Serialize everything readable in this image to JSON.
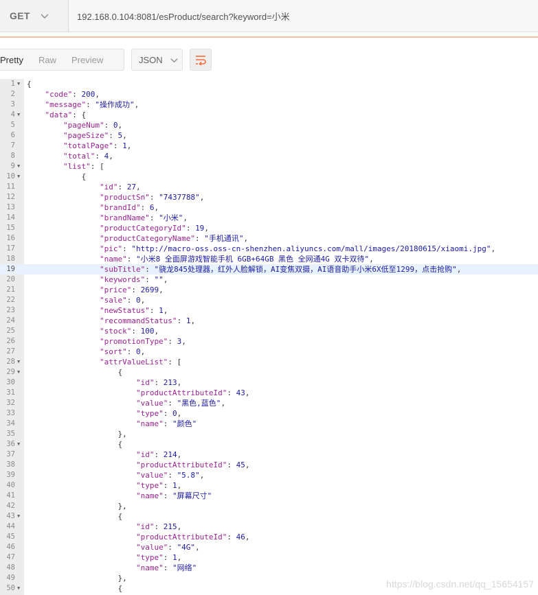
{
  "request": {
    "method": "GET",
    "url": "192.168.0.104:8081/esProduct/search?keyword=小米"
  },
  "toolbar": {
    "view_tabs": [
      "Pretty",
      "Raw",
      "Preview"
    ],
    "active_view": "Pretty",
    "format": "JSON",
    "wrap_icon": "wrap-lines-icon"
  },
  "watermark": "https://blog.csdn.net/qq_15654157",
  "code_lines": [
    {
      "n": 1,
      "fold": true,
      "indent": 0,
      "t": [
        [
          "{",
          "p"
        ]
      ]
    },
    {
      "n": 2,
      "indent": 1,
      "t": [
        [
          "\"code\"",
          "k"
        ],
        [
          ": ",
          "p"
        ],
        [
          "200",
          "n"
        ],
        [
          ",",
          "p"
        ]
      ]
    },
    {
      "n": 3,
      "indent": 1,
      "t": [
        [
          "\"message\"",
          "k"
        ],
        [
          ": ",
          "p"
        ],
        [
          "\"操作成功\"",
          "s"
        ],
        [
          ",",
          "p"
        ]
      ]
    },
    {
      "n": 4,
      "fold": true,
      "indent": 1,
      "t": [
        [
          "\"data\"",
          "k"
        ],
        [
          ": {",
          "p"
        ]
      ]
    },
    {
      "n": 5,
      "indent": 2,
      "t": [
        [
          "\"pageNum\"",
          "k"
        ],
        [
          ": ",
          "p"
        ],
        [
          "0",
          "n"
        ],
        [
          ",",
          "p"
        ]
      ]
    },
    {
      "n": 6,
      "indent": 2,
      "t": [
        [
          "\"pageSize\"",
          "k"
        ],
        [
          ": ",
          "p"
        ],
        [
          "5",
          "n"
        ],
        [
          ",",
          "p"
        ]
      ]
    },
    {
      "n": 7,
      "indent": 2,
      "t": [
        [
          "\"totalPage\"",
          "k"
        ],
        [
          ": ",
          "p"
        ],
        [
          "1",
          "n"
        ],
        [
          ",",
          "p"
        ]
      ]
    },
    {
      "n": 8,
      "indent": 2,
      "t": [
        [
          "\"total\"",
          "k"
        ],
        [
          ": ",
          "p"
        ],
        [
          "4",
          "n"
        ],
        [
          ",",
          "p"
        ]
      ]
    },
    {
      "n": 9,
      "fold": true,
      "indent": 2,
      "t": [
        [
          "\"list\"",
          "k"
        ],
        [
          ": [",
          "p"
        ]
      ]
    },
    {
      "n": 10,
      "fold": true,
      "indent": 3,
      "t": [
        [
          "{",
          "p"
        ]
      ]
    },
    {
      "n": 11,
      "indent": 4,
      "t": [
        [
          "\"id\"",
          "k"
        ],
        [
          ": ",
          "p"
        ],
        [
          "27",
          "n"
        ],
        [
          ",",
          "p"
        ]
      ]
    },
    {
      "n": 12,
      "indent": 4,
      "t": [
        [
          "\"productSn\"",
          "k"
        ],
        [
          ": ",
          "p"
        ],
        [
          "\"7437788\"",
          "s"
        ],
        [
          ",",
          "p"
        ]
      ]
    },
    {
      "n": 13,
      "indent": 4,
      "t": [
        [
          "\"brandId\"",
          "k"
        ],
        [
          ": ",
          "p"
        ],
        [
          "6",
          "n"
        ],
        [
          ",",
          "p"
        ]
      ]
    },
    {
      "n": 14,
      "indent": 4,
      "t": [
        [
          "\"brandName\"",
          "k"
        ],
        [
          ": ",
          "p"
        ],
        [
          "\"小米\"",
          "s"
        ],
        [
          ",",
          "p"
        ]
      ]
    },
    {
      "n": 15,
      "indent": 4,
      "t": [
        [
          "\"productCategoryId\"",
          "k"
        ],
        [
          ": ",
          "p"
        ],
        [
          "19",
          "n"
        ],
        [
          ",",
          "p"
        ]
      ]
    },
    {
      "n": 16,
      "indent": 4,
      "t": [
        [
          "\"productCategoryName\"",
          "k"
        ],
        [
          ": ",
          "p"
        ],
        [
          "\"手机通讯\"",
          "s"
        ],
        [
          ",",
          "p"
        ]
      ]
    },
    {
      "n": 17,
      "indent": 4,
      "t": [
        [
          "\"pic\"",
          "k"
        ],
        [
          ": ",
          "p"
        ],
        [
          "\"http://macro-oss.oss-cn-shenzhen.aliyuncs.com/mall/images/20180615/xiaomi.jpg\"",
          "s"
        ],
        [
          ",",
          "p"
        ]
      ]
    },
    {
      "n": 18,
      "indent": 4,
      "t": [
        [
          "\"name\"",
          "k"
        ],
        [
          ": ",
          "p"
        ],
        [
          "\"小米8 全面屏游戏智能手机 6GB+64GB 黑色 全网通4G 双卡双待\"",
          "s"
        ],
        [
          ",",
          "p"
        ]
      ]
    },
    {
      "n": 19,
      "hl": true,
      "indent": 4,
      "t": [
        [
          "\"subTitle\"",
          "k"
        ],
        [
          ": ",
          "p"
        ],
        [
          "\"骁龙845处理器，红外人脸解锁，AI变焦双摄，AI语音助手小米6X低至1299，点击抢购\"",
          "s"
        ],
        [
          ",",
          "p"
        ]
      ]
    },
    {
      "n": 20,
      "indent": 4,
      "t": [
        [
          "\"keywords\"",
          "k"
        ],
        [
          ": ",
          "p"
        ],
        [
          "\"\"",
          "s"
        ],
        [
          ",",
          "p"
        ]
      ]
    },
    {
      "n": 21,
      "indent": 4,
      "t": [
        [
          "\"price\"",
          "k"
        ],
        [
          ": ",
          "p"
        ],
        [
          "2699",
          "n"
        ],
        [
          ",",
          "p"
        ]
      ]
    },
    {
      "n": 22,
      "indent": 4,
      "t": [
        [
          "\"sale\"",
          "k"
        ],
        [
          ": ",
          "p"
        ],
        [
          "0",
          "n"
        ],
        [
          ",",
          "p"
        ]
      ]
    },
    {
      "n": 23,
      "indent": 4,
      "t": [
        [
          "\"newStatus\"",
          "k"
        ],
        [
          ": ",
          "p"
        ],
        [
          "1",
          "n"
        ],
        [
          ",",
          "p"
        ]
      ]
    },
    {
      "n": 24,
      "indent": 4,
      "t": [
        [
          "\"recommandStatus\"",
          "k"
        ],
        [
          ": ",
          "p"
        ],
        [
          "1",
          "n"
        ],
        [
          ",",
          "p"
        ]
      ]
    },
    {
      "n": 25,
      "indent": 4,
      "t": [
        [
          "\"stock\"",
          "k"
        ],
        [
          ": ",
          "p"
        ],
        [
          "100",
          "n"
        ],
        [
          ",",
          "p"
        ]
      ]
    },
    {
      "n": 26,
      "indent": 4,
      "t": [
        [
          "\"promotionType\"",
          "k"
        ],
        [
          ": ",
          "p"
        ],
        [
          "3",
          "n"
        ],
        [
          ",",
          "p"
        ]
      ]
    },
    {
      "n": 27,
      "indent": 4,
      "t": [
        [
          "\"sort\"",
          "k"
        ],
        [
          ": ",
          "p"
        ],
        [
          "0",
          "n"
        ],
        [
          ",",
          "p"
        ]
      ]
    },
    {
      "n": 28,
      "fold": true,
      "indent": 4,
      "t": [
        [
          "\"attrValueList\"",
          "k"
        ],
        [
          ": [",
          "p"
        ]
      ]
    },
    {
      "n": 29,
      "fold": true,
      "indent": 5,
      "t": [
        [
          "{",
          "p"
        ]
      ]
    },
    {
      "n": 30,
      "indent": 6,
      "t": [
        [
          "\"id\"",
          "k"
        ],
        [
          ": ",
          "p"
        ],
        [
          "213",
          "n"
        ],
        [
          ",",
          "p"
        ]
      ]
    },
    {
      "n": 31,
      "indent": 6,
      "t": [
        [
          "\"productAttributeId\"",
          "k"
        ],
        [
          ": ",
          "p"
        ],
        [
          "43",
          "n"
        ],
        [
          ",",
          "p"
        ]
      ]
    },
    {
      "n": 32,
      "indent": 6,
      "t": [
        [
          "\"value\"",
          "k"
        ],
        [
          ": ",
          "p"
        ],
        [
          "\"黑色,蓝色\"",
          "s"
        ],
        [
          ",",
          "p"
        ]
      ]
    },
    {
      "n": 33,
      "indent": 6,
      "t": [
        [
          "\"type\"",
          "k"
        ],
        [
          ": ",
          "p"
        ],
        [
          "0",
          "n"
        ],
        [
          ",",
          "p"
        ]
      ]
    },
    {
      "n": 34,
      "indent": 6,
      "t": [
        [
          "\"name\"",
          "k"
        ],
        [
          ": ",
          "p"
        ],
        [
          "\"颜色\"",
          "s"
        ]
      ]
    },
    {
      "n": 35,
      "indent": 5,
      "t": [
        [
          "},",
          "p"
        ]
      ]
    },
    {
      "n": 36,
      "fold": true,
      "indent": 5,
      "t": [
        [
          "{",
          "p"
        ]
      ]
    },
    {
      "n": 37,
      "indent": 6,
      "t": [
        [
          "\"id\"",
          "k"
        ],
        [
          ": ",
          "p"
        ],
        [
          "214",
          "n"
        ],
        [
          ",",
          "p"
        ]
      ]
    },
    {
      "n": 38,
      "indent": 6,
      "t": [
        [
          "\"productAttributeId\"",
          "k"
        ],
        [
          ": ",
          "p"
        ],
        [
          "45",
          "n"
        ],
        [
          ",",
          "p"
        ]
      ]
    },
    {
      "n": 39,
      "indent": 6,
      "t": [
        [
          "\"value\"",
          "k"
        ],
        [
          ": ",
          "p"
        ],
        [
          "\"5.8\"",
          "s"
        ],
        [
          ",",
          "p"
        ]
      ]
    },
    {
      "n": 40,
      "indent": 6,
      "t": [
        [
          "\"type\"",
          "k"
        ],
        [
          ": ",
          "p"
        ],
        [
          "1",
          "n"
        ],
        [
          ",",
          "p"
        ]
      ]
    },
    {
      "n": 41,
      "indent": 6,
      "t": [
        [
          "\"name\"",
          "k"
        ],
        [
          ": ",
          "p"
        ],
        [
          "\"屏幕尺寸\"",
          "s"
        ]
      ]
    },
    {
      "n": 42,
      "indent": 5,
      "t": [
        [
          "},",
          "p"
        ]
      ]
    },
    {
      "n": 43,
      "fold": true,
      "indent": 5,
      "t": [
        [
          "{",
          "p"
        ]
      ]
    },
    {
      "n": 44,
      "indent": 6,
      "t": [
        [
          "\"id\"",
          "k"
        ],
        [
          ": ",
          "p"
        ],
        [
          "215",
          "n"
        ],
        [
          ",",
          "p"
        ]
      ]
    },
    {
      "n": 45,
      "indent": 6,
      "t": [
        [
          "\"productAttributeId\"",
          "k"
        ],
        [
          ": ",
          "p"
        ],
        [
          "46",
          "n"
        ],
        [
          ",",
          "p"
        ]
      ]
    },
    {
      "n": 46,
      "indent": 6,
      "t": [
        [
          "\"value\"",
          "k"
        ],
        [
          ": ",
          "p"
        ],
        [
          "\"4G\"",
          "s"
        ],
        [
          ",",
          "p"
        ]
      ]
    },
    {
      "n": 47,
      "indent": 6,
      "t": [
        [
          "\"type\"",
          "k"
        ],
        [
          ": ",
          "p"
        ],
        [
          "1",
          "n"
        ],
        [
          ",",
          "p"
        ]
      ]
    },
    {
      "n": 48,
      "indent": 6,
      "t": [
        [
          "\"name\"",
          "k"
        ],
        [
          ": ",
          "p"
        ],
        [
          "\"网络\"",
          "s"
        ]
      ]
    },
    {
      "n": 49,
      "indent": 5,
      "t": [
        [
          "},",
          "p"
        ]
      ]
    },
    {
      "n": 50,
      "fold": true,
      "indent": 5,
      "t": [
        [
          "{",
          "p"
        ]
      ]
    }
  ]
}
